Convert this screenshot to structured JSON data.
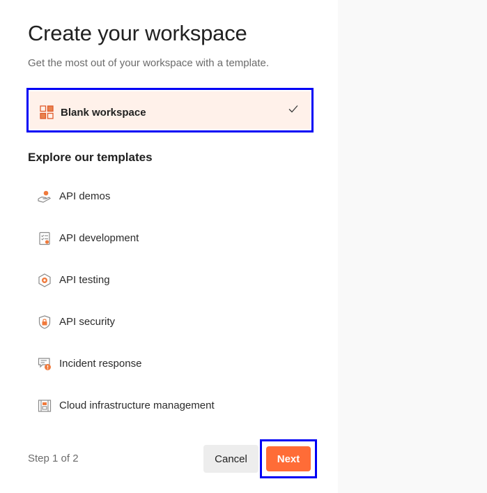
{
  "header": {
    "title": "Create your workspace",
    "subtitle": "Get the most out of your workspace with a template."
  },
  "blank": {
    "label": "Blank workspace",
    "selected": true,
    "icon": "grid-icon"
  },
  "templates_heading": "Explore our templates",
  "templates": [
    {
      "label": "API demos",
      "icon": "hand-icon"
    },
    {
      "label": "API development",
      "icon": "checklist-icon"
    },
    {
      "label": "API testing",
      "icon": "gear-hexagon-icon"
    },
    {
      "label": "API security",
      "icon": "lock-shield-icon"
    },
    {
      "label": "Incident response",
      "icon": "alert-message-icon"
    },
    {
      "label": "Cloud infrastructure management",
      "icon": "server-icon"
    }
  ],
  "footer": {
    "step": "Step 1 of 2",
    "cancel_label": "Cancel",
    "next_label": "Next"
  },
  "colors": {
    "accent": "#ff6c37",
    "selected_bg": "#fff1ea",
    "highlight_border": "#0000f5",
    "side_panel": "#f9f9f9"
  }
}
